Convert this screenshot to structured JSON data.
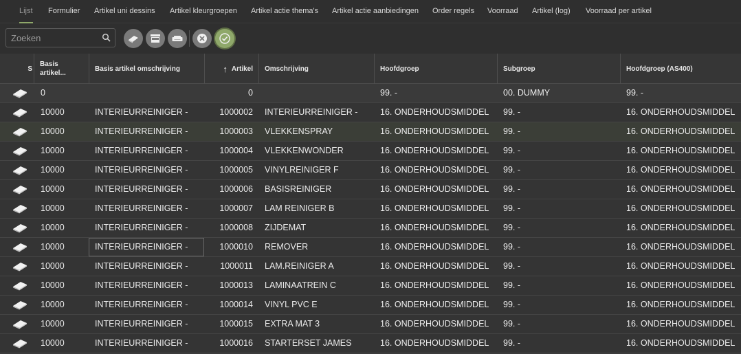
{
  "tabs": [
    {
      "label": "Lijst",
      "active": true
    },
    {
      "label": "Formulier"
    },
    {
      "label": "Artikel uni dessins"
    },
    {
      "label": "Artikel kleurgroepen"
    },
    {
      "label": "Artikel actie thema's"
    },
    {
      "label": "Artikel actie aanbiedingen"
    },
    {
      "label": "Order regels"
    },
    {
      "label": "Voorraad"
    },
    {
      "label": "Artikel (log)"
    },
    {
      "label": "Voorraad per artikel"
    }
  ],
  "search": {
    "placeholder": "Zoeken",
    "value": ""
  },
  "toolbar": {
    "buttons": [
      "sofa-cushion-icon",
      "cabinet-icon",
      "sofa-icon",
      "cancel-icon",
      "confirm-check-icon"
    ]
  },
  "colors": {
    "accent": "#8fa86a",
    "background": "#2b2b2b",
    "header": "#363636"
  },
  "table": {
    "columns": [
      "S",
      "Basis artikel...",
      "Basis artikel omschrijving",
      "Artikel",
      "Omschrijving",
      "Hoofdgroep",
      "Subgroep",
      "Hoofdgroep (AS400)"
    ],
    "sort": {
      "column": "Artikel",
      "direction": "ascending"
    },
    "rows": [
      {
        "basis": "0",
        "basis_oms": "",
        "artikel": "0",
        "oms": "",
        "hoofdgroep": "99. -",
        "subgroep": "00. DUMMY",
        "hoofdgroep_as400": "99. -"
      },
      {
        "basis": "10000",
        "basis_oms": "INTERIEURREINIGER -",
        "artikel": "1000002",
        "oms": "INTERIEURREINIGER -",
        "hoofdgroep": "16. ONDERHOUDSMIDDEL",
        "subgroep": "99. -",
        "hoofdgroep_as400": "16. ONDERHOUDSMIDDEL"
      },
      {
        "basis": "10000",
        "basis_oms": "INTERIEURREINIGER -",
        "artikel": "1000003",
        "oms": "VLEKKENSPRAY",
        "hoofdgroep": "16. ONDERHOUDSMIDDEL",
        "subgroep": "99. -",
        "hoofdgroep_as400": "16. ONDERHOUDSMIDDEL"
      },
      {
        "basis": "10000",
        "basis_oms": "INTERIEURREINIGER -",
        "artikel": "1000004",
        "oms": "VLEKKENWONDER",
        "hoofdgroep": "16. ONDERHOUDSMIDDEL",
        "subgroep": "99. -",
        "hoofdgroep_as400": "16. ONDERHOUDSMIDDEL"
      },
      {
        "basis": "10000",
        "basis_oms": "INTERIEURREINIGER -",
        "artikel": "1000005",
        "oms": "VINYLREINIGER F",
        "hoofdgroep": "16. ONDERHOUDSMIDDEL",
        "subgroep": "99. -",
        "hoofdgroep_as400": "16. ONDERHOUDSMIDDEL"
      },
      {
        "basis": "10000",
        "basis_oms": "INTERIEURREINIGER -",
        "artikel": "1000006",
        "oms": "BASISREINIGER",
        "hoofdgroep": "16. ONDERHOUDSMIDDEL",
        "subgroep": "99. -",
        "hoofdgroep_as400": "16. ONDERHOUDSMIDDEL"
      },
      {
        "basis": "10000",
        "basis_oms": "INTERIEURREINIGER -",
        "artikel": "1000007",
        "oms": "LAM REINIGER B",
        "hoofdgroep": "16. ONDERHOUDSMIDDEL",
        "subgroep": "99. -",
        "hoofdgroep_as400": "16. ONDERHOUDSMIDDEL"
      },
      {
        "basis": "10000",
        "basis_oms": "INTERIEURREINIGER -",
        "artikel": "1000008",
        "oms": "ZIJDEMAT",
        "hoofdgroep": "16. ONDERHOUDSMIDDEL",
        "subgroep": "99. -",
        "hoofdgroep_as400": "16. ONDERHOUDSMIDDEL"
      },
      {
        "basis": "10000",
        "basis_oms": "INTERIEURREINIGER -",
        "artikel": "1000010",
        "oms": "REMOVER",
        "hoofdgroep": "16. ONDERHOUDSMIDDEL",
        "subgroep": "99. -",
        "hoofdgroep_as400": "16. ONDERHOUDSMIDDEL"
      },
      {
        "basis": "10000",
        "basis_oms": "INTERIEURREINIGER -",
        "artikel": "1000011",
        "oms": "LAM.REINIGER A",
        "hoofdgroep": "16. ONDERHOUDSMIDDEL",
        "subgroep": "99. -",
        "hoofdgroep_as400": "16. ONDERHOUDSMIDDEL"
      },
      {
        "basis": "10000",
        "basis_oms": "INTERIEURREINIGER -",
        "artikel": "1000013",
        "oms": "LAMINAATREIN C",
        "hoofdgroep": "16. ONDERHOUDSMIDDEL",
        "subgroep": "99. -",
        "hoofdgroep_as400": "16. ONDERHOUDSMIDDEL"
      },
      {
        "basis": "10000",
        "basis_oms": "INTERIEURREINIGER -",
        "artikel": "1000014",
        "oms": "VINYL PVC E",
        "hoofdgroep": "16. ONDERHOUDSMIDDEL",
        "subgroep": "99. -",
        "hoofdgroep_as400": "16. ONDERHOUDSMIDDEL"
      },
      {
        "basis": "10000",
        "basis_oms": "INTERIEURREINIGER -",
        "artikel": "1000015",
        "oms": "EXTRA MAT 3",
        "hoofdgroep": "16. ONDERHOUDSMIDDEL",
        "subgroep": "99. -",
        "hoofdgroep_as400": "16. ONDERHOUDSMIDDEL"
      },
      {
        "basis": "10000",
        "basis_oms": "INTERIEURREINIGER -",
        "artikel": "1000016",
        "oms": "STARTERSET JAMES",
        "hoofdgroep": "16. ONDERHOUDSMIDDEL",
        "subgroep": "99. -",
        "hoofdgroep_as400": "16. ONDERHOUDSMIDDEL"
      }
    ]
  }
}
